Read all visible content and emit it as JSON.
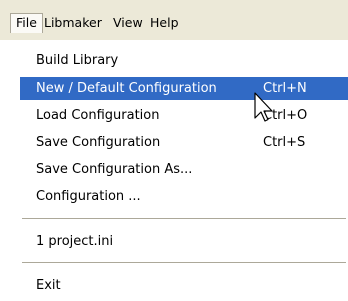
{
  "menubar": {
    "items": [
      {
        "label": "File"
      },
      {
        "label": "Libmaker"
      },
      {
        "label": "View"
      },
      {
        "label": "Help"
      }
    ]
  },
  "file_menu": {
    "items": [
      {
        "label": "Build Library",
        "shortcut": ""
      },
      {
        "label": "New / Default Configuration",
        "shortcut": "Ctrl+N"
      },
      {
        "label": "Load Configuration",
        "shortcut": "Ctrl+O"
      },
      {
        "label": "Save Configuration",
        "shortcut": "Ctrl+S"
      },
      {
        "label": "Save Configuration As...",
        "shortcut": ""
      },
      {
        "label": "Configuration ...",
        "shortcut": ""
      },
      {
        "label": "1 project.ini",
        "shortcut": ""
      },
      {
        "label": "Exit",
        "shortcut": ""
      }
    ]
  },
  "colors": {
    "highlight": "#316ac5",
    "menubar_bg": "#ece9d8"
  }
}
